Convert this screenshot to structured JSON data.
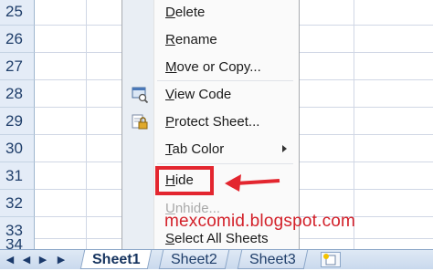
{
  "grid": {
    "rows": [
      "25",
      "26",
      "27",
      "28",
      "29",
      "30",
      "31",
      "32",
      "33",
      "34"
    ]
  },
  "menu": {
    "items": [
      {
        "label": "Delete",
        "accel": "D",
        "rest": "elete"
      },
      {
        "label": "Rename",
        "accel": "R",
        "rest": "ename"
      },
      {
        "label": "Move or Copy...",
        "accel": "M",
        "rest": "ove or Copy..."
      },
      {
        "label": "View Code",
        "accel": "V",
        "rest": "iew Code"
      },
      {
        "label": "Protect Sheet...",
        "accel": "P",
        "rest": "rotect Sheet..."
      },
      {
        "label": "Tab Color",
        "accel": "T",
        "rest": "ab Color"
      },
      {
        "label": "Hide",
        "accel": "H",
        "rest": "ide"
      },
      {
        "label": "Unhide...",
        "accel": "U",
        "rest": "nhide..."
      },
      {
        "label": "Select All Sheets",
        "accel": "S",
        "rest": "elect All Sheets"
      }
    ]
  },
  "tabs": {
    "sheets": [
      "Sheet1",
      "Sheet2",
      "Sheet3"
    ],
    "active": "Sheet1"
  },
  "watermark": "mexcomid.blogspot.com",
  "colors": {
    "highlight": "#e3262f",
    "watermark": "#d3212a"
  }
}
